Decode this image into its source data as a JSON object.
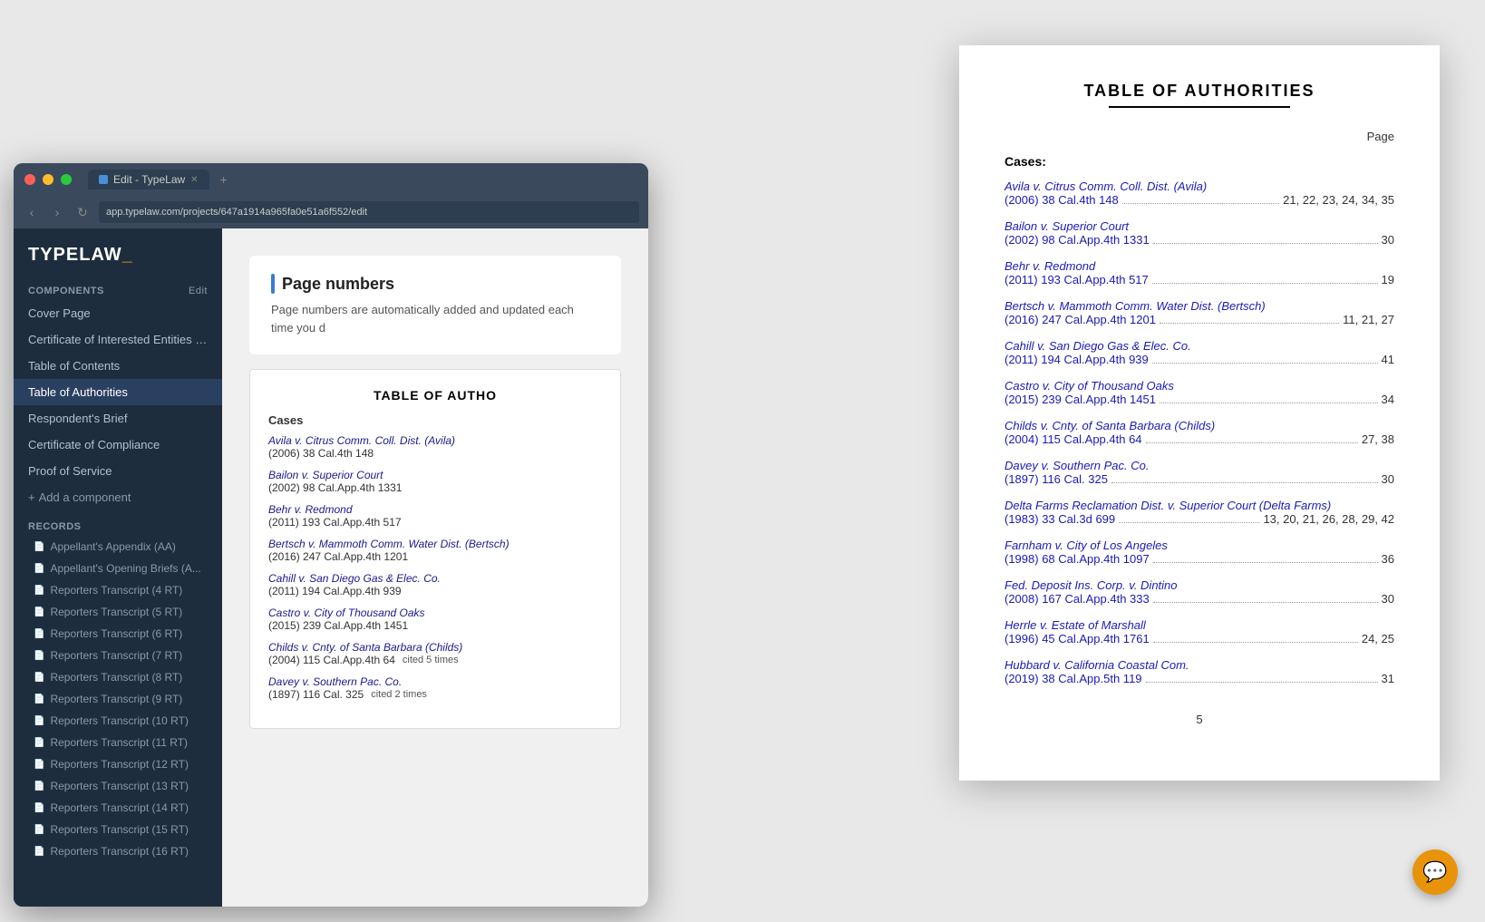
{
  "browser": {
    "tab_title": "Edit - TypeLaw",
    "url": "app.typelaw.com/projects/647a1914a965fa0e51a6f552/edit",
    "dots": [
      "red",
      "yellow",
      "green"
    ]
  },
  "logo": {
    "type": "TYPE",
    "law": "LAW",
    "dash": "_"
  },
  "components_section": {
    "label": "COMPONENTS",
    "edit_label": "Edit",
    "items": [
      {
        "id": "cover-page",
        "label": "Cover Page"
      },
      {
        "id": "certificate-interested",
        "label": "Certificate of Interested Entities o..."
      },
      {
        "id": "table-of-contents",
        "label": "Table of Contents"
      },
      {
        "id": "table-of-authorities",
        "label": "Table of Authorities",
        "active": true
      },
      {
        "id": "respondents-brief",
        "label": "Respondent's Brief"
      },
      {
        "id": "certificate-compliance",
        "label": "Certificate of Compliance"
      },
      {
        "id": "proof-of-service",
        "label": "Proof of Service"
      },
      {
        "id": "add-component",
        "label": "+ Add a component"
      }
    ]
  },
  "records_section": {
    "label": "RECORDS",
    "items": [
      "Appellant's Appendix (AA)",
      "Appellant's Opening Briefs (A...",
      "Reporters Transcript (4 RT)",
      "Reporters Transcript (5 RT)",
      "Reporters Transcript (6 RT)",
      "Reporters Transcript (7 RT)",
      "Reporters Transcript (8 RT)",
      "Reporters Transcript (9 RT)",
      "Reporters Transcript (10 RT)",
      "Reporters Transcript (11 RT)",
      "Reporters Transcript (12 RT)",
      "Reporters Transcript (13 RT)",
      "Reporters Transcript (14 RT)",
      "Reporters Transcript (15 RT)",
      "Reporters Transcript (16 RT)"
    ]
  },
  "main_panel": {
    "section_title": "Page numbers",
    "section_desc": "Page numbers are automatically added and updated each time you d",
    "toa_preview_title": "TABLE OF AUTHO",
    "cases_label": "Cases",
    "cases": [
      {
        "name": "Avila v. Citrus Comm. Coll. Dist. (Avila)",
        "citation": "(2006) 38 Cal.4th 148"
      },
      {
        "name": "Bailon v. Superior Court",
        "citation": "(2002) 98 Cal.App.4th 1331"
      },
      {
        "name": "Behr v. Redmond",
        "citation": "(2011) 193 Cal.App.4th 517"
      },
      {
        "name": "Bertsch v. Mammoth Comm. Water Dist. (Bertsch)",
        "citation": "(2016) 247 Cal.App.4th 1201"
      },
      {
        "name": "Cahill v. San Diego Gas & Elec. Co.",
        "citation": "(2011) 194 Cal.App.4th 939"
      },
      {
        "name": "Castro v. City of Thousand Oaks",
        "citation": "(2015) 239 Cal.App.4th 1451"
      },
      {
        "name": "Childs v. Cnty. of Santa Barbara (Childs)",
        "citation": "(2004) 115 Cal.App.4th 64",
        "cited": "cited 5 times"
      },
      {
        "name": "Davey v. Southern Pac. Co.",
        "citation": "(1897) 116 Cal. 325",
        "cited": "cited 2 times"
      }
    ]
  },
  "document": {
    "title": "TABLE OF AUTHORITIES",
    "page_col_label": "Page",
    "cases_heading": "Cases:",
    "cases": [
      {
        "name": "Avila v. Citrus Comm. Coll. Dist. (Avila)",
        "citation": "(2006) 38 Cal.4th 148",
        "pages": "21, 22, 23, 24, 34, 35"
      },
      {
        "name": "Bailon v. Superior Court",
        "citation": "(2002) 98 Cal.App.4th 1331",
        "pages": "30"
      },
      {
        "name": "Behr v. Redmond",
        "citation": "(2011) 193 Cal.App.4th 517",
        "pages": "19"
      },
      {
        "name": "Bertsch v. Mammoth Comm. Water Dist. (Bertsch)",
        "citation": "(2016) 247 Cal.App.4th 1201",
        "pages": "11, 21, 27"
      },
      {
        "name": "Cahill v. San Diego Gas & Elec. Co.",
        "citation": "(2011) 194 Cal.App.4th 939",
        "pages": "41"
      },
      {
        "name": "Castro v. City of Thousand Oaks",
        "citation": "(2015) 239 Cal.App.4th 1451",
        "pages": "34"
      },
      {
        "name": "Childs v. Cnty. of Santa Barbara (Childs)",
        "citation": "(2004) 115 Cal.App.4th 64",
        "pages": "27, 38"
      },
      {
        "name": "Davey v. Southern Pac. Co.",
        "citation": "(1897) 116 Cal. 325",
        "pages": "30"
      },
      {
        "name": "Delta Farms Reclamation Dist. v. Superior Court (Delta Farms)",
        "citation": "(1983) 33 Cal.3d 699",
        "pages": "13, 20, 21, 26, 28, 29, 42"
      },
      {
        "name": "Farnham v. City of Los Angeles",
        "citation": "(1998) 68 Cal.App.4th 1097",
        "pages": "36"
      },
      {
        "name": "Fed. Deposit Ins. Corp. v. Dintino",
        "citation": "(2008) 167 Cal.App.4th 333",
        "pages": "30"
      },
      {
        "name": "Herrle v. Estate of Marshall",
        "citation": "(1996) 45 Cal.App.4th 1761",
        "pages": "24, 25"
      },
      {
        "name": "Hubbard v. California Coastal Com.",
        "citation": "(2019) 38 Cal.App.5th 119",
        "pages": "31"
      }
    ],
    "page_number": "5"
  },
  "chat": {
    "icon": "💬"
  }
}
